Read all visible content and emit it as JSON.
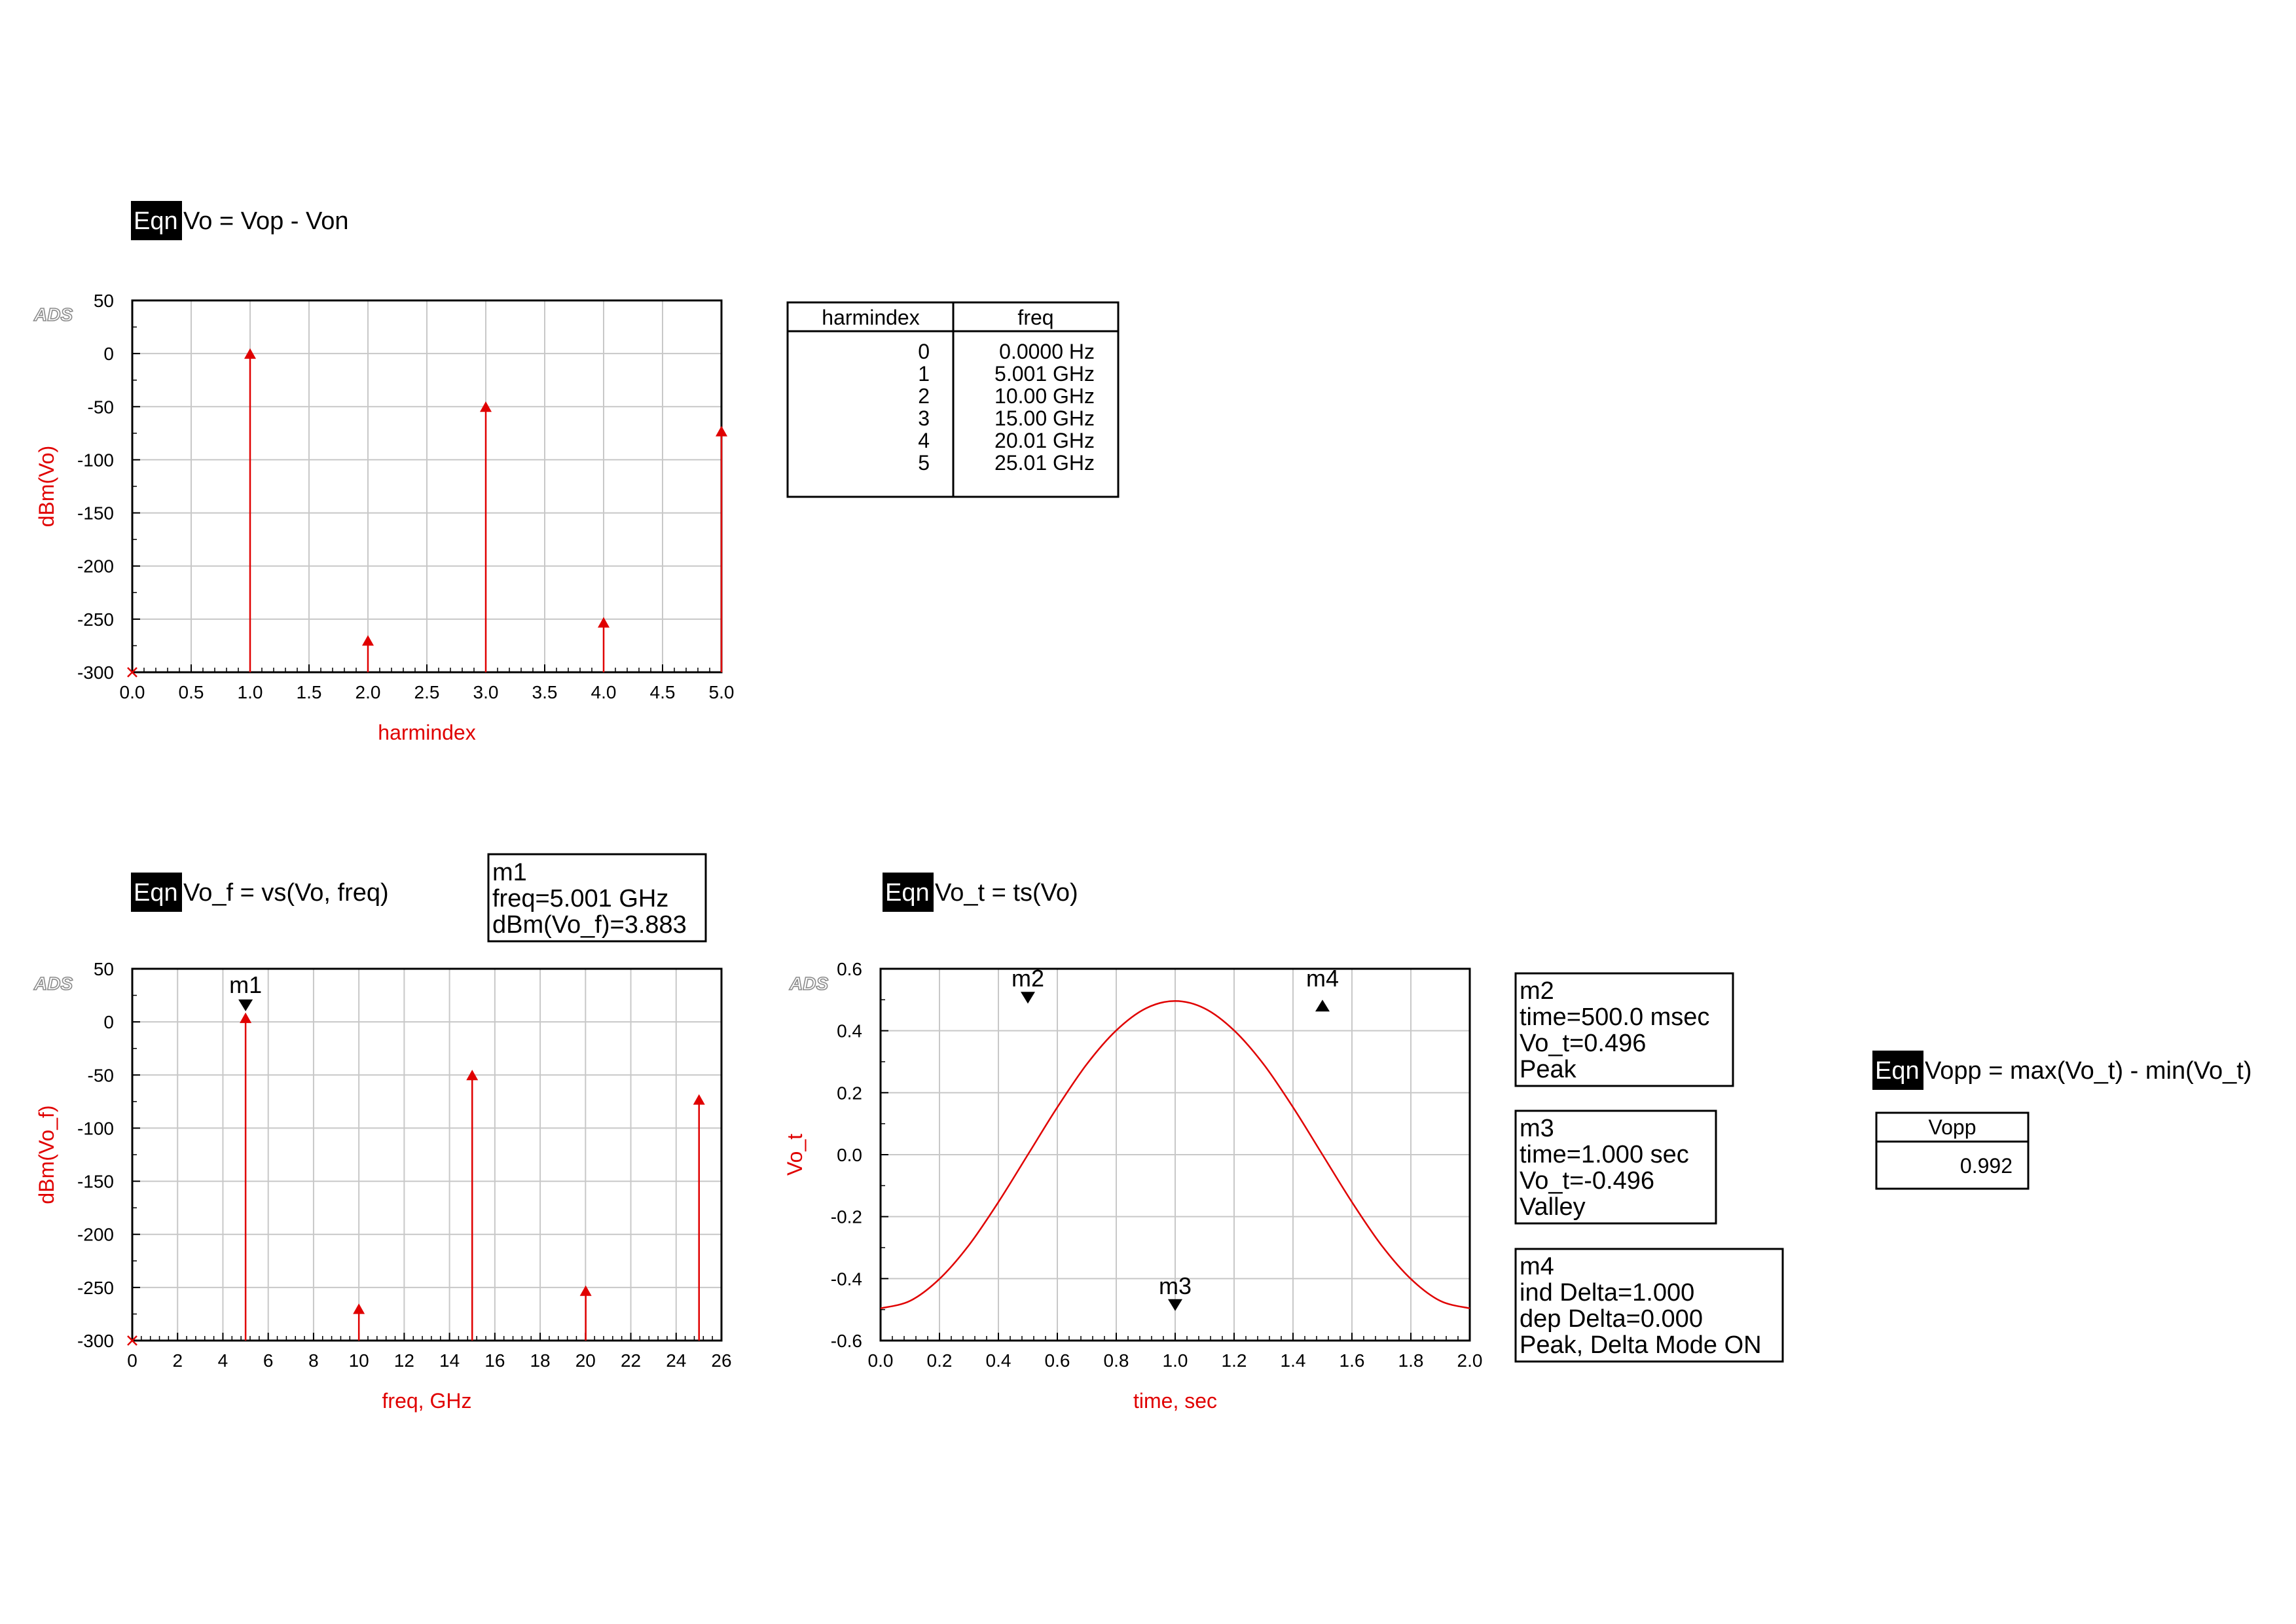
{
  "equations": {
    "eq1": {
      "tag": "Eqn",
      "text": "Vo = Vop - Von"
    },
    "eq2": {
      "tag": "Eqn",
      "text": "Vo_f = vs(Vo, freq)"
    },
    "eq3": {
      "tag": "Eqn",
      "text": "Vo_t = ts(Vo)"
    },
    "eq4": {
      "tag": "Eqn",
      "text": "Vopp = max(Vo_t) - min(Vo_t)"
    }
  },
  "logo": "ADS",
  "harm_table": {
    "headers": [
      "harmindex",
      "freq"
    ],
    "rows": [
      [
        "0",
        "0.0000 Hz"
      ],
      [
        "1",
        "5.001 GHz"
      ],
      [
        "2",
        "10.00 GHz"
      ],
      [
        "3",
        "15.00 GHz"
      ],
      [
        "4",
        "20.01 GHz"
      ],
      [
        "5",
        "25.01 GHz"
      ]
    ]
  },
  "vopp_table": {
    "header": "Vopp",
    "value": "0.992"
  },
  "markers": {
    "m1": [
      "m1",
      "freq=5.001 GHz",
      "dBm(Vo_f)=3.883"
    ],
    "m2": [
      "m2",
      "time=500.0 msec",
      "Vo_t=0.496",
      "Peak"
    ],
    "m3": [
      "m3",
      "time=1.000  sec",
      "Vo_t=-0.496",
      "Valley"
    ],
    "m4": [
      "m4",
      "ind Delta=1.000",
      "dep Delta=0.000",
      "Peak, Delta Mode ON"
    ]
  },
  "colors": {
    "trace": "#e00000",
    "grid": "#c8c8c8",
    "axis": "#000000"
  },
  "chart_data": [
    {
      "type": "bar",
      "xlabel": "harmindex",
      "ylabel": "dBm(Vo)",
      "xlim": [
        0,
        5
      ],
      "ylim": [
        -300,
        50
      ],
      "xticks": [
        "0.0",
        "0.5",
        "1.0",
        "1.5",
        "2.0",
        "2.5",
        "3.0",
        "3.5",
        "4.0",
        "4.5",
        "5.0"
      ],
      "yticks": [
        "50",
        "0",
        "-50",
        "-100",
        "-150",
        "-200",
        "-250",
        "-300"
      ],
      "grid": true,
      "x": [
        0,
        1,
        2,
        3,
        4,
        5
      ],
      "values": [
        -300,
        0,
        -270,
        -50,
        -253,
        -73
      ]
    },
    {
      "type": "bar",
      "xlabel": "freq, GHz",
      "ylabel": "dBm(Vo_f)",
      "xlim": [
        0,
        26
      ],
      "ylim": [
        -300,
        50
      ],
      "xticks": [
        "0",
        "2",
        "4",
        "6",
        "8",
        "10",
        "12",
        "14",
        "16",
        "18",
        "20",
        "22",
        "24",
        "26"
      ],
      "yticks": [
        "50",
        "0",
        "-50",
        "-100",
        "-150",
        "-200",
        "-250",
        "-300"
      ],
      "grid": true,
      "x": [
        0,
        5.001,
        10.0,
        15.0,
        20.01,
        25.01
      ],
      "values": [
        -300,
        3.883,
        -270,
        -50,
        -253,
        -73
      ],
      "marker": {
        "label": "m1",
        "x": 5.001,
        "y": 3.883
      }
    },
    {
      "type": "line",
      "xlabel": "time, sec",
      "ylabel": "Vo_t",
      "xlim": [
        0,
        2.0
      ],
      "ylim": [
        -0.6,
        0.6
      ],
      "xticks": [
        "0.0",
        "0.2",
        "0.4",
        "0.6",
        "0.8",
        "1.0",
        "1.2",
        "1.4",
        "1.6",
        "1.8",
        "2.0"
      ],
      "yticks": [
        "0.6",
        "0.4",
        "0.2",
        "0.0",
        "-0.2",
        "-0.4",
        "-0.6"
      ],
      "grid": true,
      "x": [
        0.0,
        0.1,
        0.2,
        0.3,
        0.4,
        0.5,
        0.6,
        0.7,
        0.8,
        0.9,
        1.0,
        1.1,
        1.2,
        1.3,
        1.4,
        1.5,
        1.6,
        1.7,
        1.8,
        1.9,
        2.0
      ],
      "y": [
        -0.496,
        -0.472,
        -0.401,
        -0.292,
        -0.153,
        0.0,
        0.153,
        0.292,
        0.401,
        0.472,
        0.496,
        0.472,
        0.401,
        0.292,
        0.153,
        0.0,
        -0.153,
        -0.292,
        -0.401,
        -0.472,
        -0.496
      ],
      "series_y_note_free": true,
      "markers": [
        {
          "label": "m2",
          "x": 0.5,
          "y": 0.496,
          "dir": "down"
        },
        {
          "label": "m3",
          "x": 1.0,
          "y": -0.496,
          "dir": "down"
        },
        {
          "label": "m4",
          "x": 1.5,
          "y": 0.496,
          "dir": "up"
        }
      ]
    }
  ]
}
